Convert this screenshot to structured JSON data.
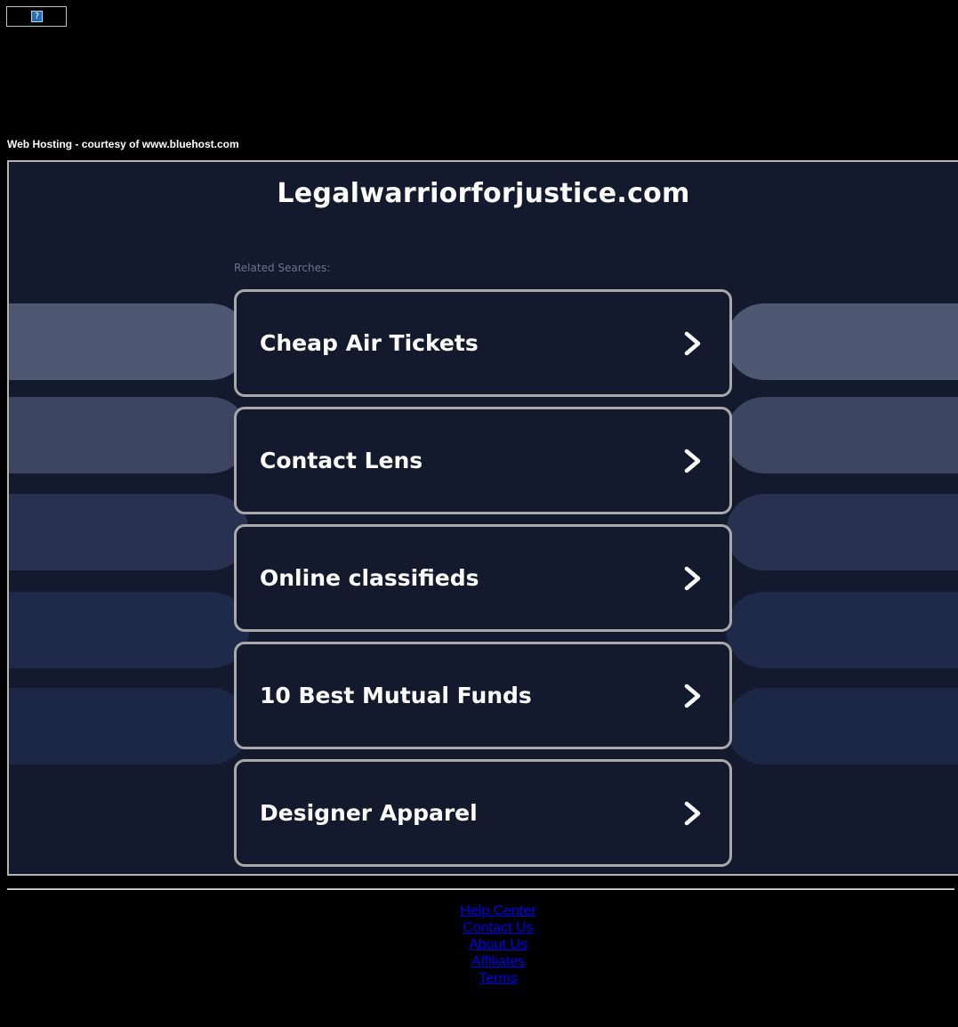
{
  "header": {
    "broken_image_glyph": "?",
    "courtesy_text": "Web Hosting - courtesy of www.bluehost.com"
  },
  "main": {
    "site_title": "Legalwarriorforjustice.com",
    "related_label": "Related Searches:",
    "searches": [
      {
        "label": "Cheap Air Tickets",
        "icon": "chevron-right-icon"
      },
      {
        "label": "Contact Lens",
        "icon": "chevron-right-icon"
      },
      {
        "label": "Online classifieds",
        "icon": "chevron-right-icon"
      },
      {
        "label": "10 Best Mutual Funds",
        "icon": "chevron-right-icon"
      },
      {
        "label": "Designer Apparel",
        "icon": "chevron-right-icon"
      }
    ]
  },
  "footer": {
    "links": [
      "Help Center",
      "Contact Us",
      "About Us",
      "Affiliates",
      "Terms"
    ]
  },
  "colors": {
    "page_background": "#000000",
    "frame_background": "#131a2e",
    "button_border": "#a9a9a9",
    "link": "#0000ee"
  }
}
